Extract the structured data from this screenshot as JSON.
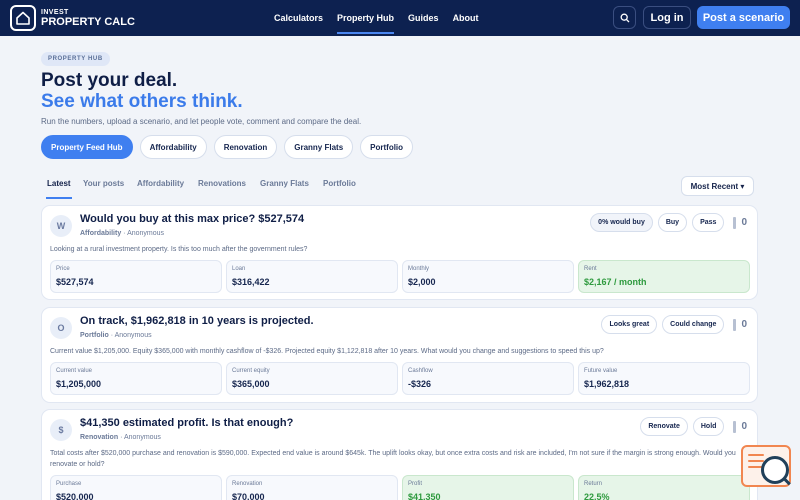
{
  "header": {
    "logo_small": "INVEST",
    "logo_big": "PROPERTY CALC",
    "nav": [
      "Calculators",
      "Property Hub",
      "Guides",
      "About"
    ],
    "nav_active": "Property Hub",
    "search_icon": "search-icon",
    "login": "Log in",
    "post": "Post a scenario"
  },
  "hero": {
    "badge": "PROPERTY HUB",
    "title_line1": "Post your deal.",
    "title_line2": "See what others think.",
    "subtitle": "Run the numbers, upload a scenario, and let people vote, comment and compare the deal."
  },
  "pills": [
    "Property Feed Hub",
    "Affordability",
    "Renovation",
    "Granny Flats",
    "Portfolio"
  ],
  "tabs": [
    "Latest",
    "Your posts",
    "Affordability",
    "Renovations",
    "Granny Flats",
    "Portfolio"
  ],
  "sort": "Most Recent ▾",
  "cards": [
    {
      "avatar": "W",
      "title": "Would you buy at this max price? $527,574",
      "category": "Affordability",
      "author": "Anonymous",
      "desc": "Looking at a rural investment property. Is this too much after the government rules?",
      "actions": [
        "0% would buy",
        "Buy",
        "Pass"
      ],
      "votes": "0",
      "stats": [
        {
          "label": "Price",
          "value": "$527,574"
        },
        {
          "label": "Loan",
          "value": "$316,422"
        },
        {
          "label": "Monthly",
          "value": "$2,000"
        },
        {
          "label": "Rent",
          "value": "$2,167 / month"
        }
      ]
    },
    {
      "avatar": "O",
      "title": "On track, $1,962,818 in 10 years is projected.",
      "category": "Portfolio",
      "author": "Anonymous",
      "desc": "Current value $1,205,000. Equity $365,000 with monthly cashflow of -$326. Projected equity $1,122,818 after 10 years. What would you change and suggestions to speed this up?",
      "actions": [
        "Looks great",
        "Could change"
      ],
      "votes": "0",
      "stats": [
        {
          "label": "Current value",
          "value": "$1,205,000"
        },
        {
          "label": "Current equity",
          "value": "$365,000"
        },
        {
          "label": "Cashflow",
          "value": "-$326"
        },
        {
          "label": "Future value",
          "value": "$1,962,818"
        }
      ]
    },
    {
      "avatar": "$",
      "title": "$41,350 estimated profit. Is that enough?",
      "category": "Renovation",
      "author": "Anonymous",
      "desc": "Total costs after $520,000 purchase and renovation is $590,000. Expected end value is around $645k. The uplift looks okay, but once extra costs and risk are included, I'm not sure if the margin is strong enough. Would you renovate or hold?",
      "actions": [
        "Renovate",
        "Hold"
      ],
      "votes": "0",
      "stats": [
        {
          "label": "Purchase",
          "value": "$520,000"
        },
        {
          "label": "Renovation",
          "value": "$70,000"
        },
        {
          "label": "Profit",
          "value": "$41,350"
        },
        {
          "label": "Return",
          "value": "22.5%"
        }
      ]
    }
  ],
  "chat_widget_icon": "chat-search-icon"
}
